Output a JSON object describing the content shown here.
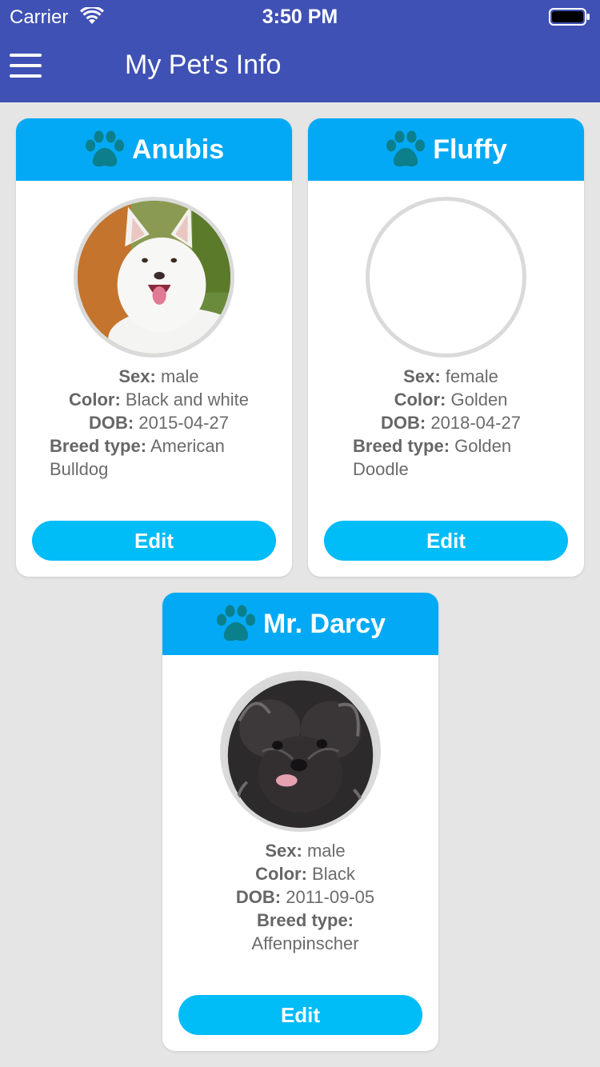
{
  "status_bar": {
    "carrier": "Carrier",
    "time": "3:50 PM"
  },
  "header": {
    "title": "My Pet's Info",
    "menu_icon": "hamburger-menu-icon"
  },
  "colors": {
    "header": "#3f51b5",
    "card_header": "#03a9f4",
    "paw": "#0b7f8c",
    "edit_button": "#00bcf7",
    "background": "#e5e5e5"
  },
  "labels": {
    "sex": "Sex:",
    "color": "Color:",
    "dob": "DOB:",
    "breed": "Breed type:"
  },
  "pets": [
    {
      "name": "Anubis",
      "photo": "white fluffy dog",
      "sex": "male",
      "color": "Black and white",
      "dob": "2015-04-27",
      "breed": "American Bulldog",
      "edit_label": "Edit"
    },
    {
      "name": "Fluffy",
      "photo": "",
      "sex": "female",
      "color": "Golden",
      "dob": "2018-04-27",
      "breed": "Golden Doodle",
      "edit_label": "Edit"
    },
    {
      "name": "Mr. Darcy",
      "photo": "black scruffy dog",
      "sex": "male",
      "color": "Black",
      "dob": "2011-09-05",
      "breed": "Affenpinscher",
      "edit_label": "Edit"
    }
  ]
}
